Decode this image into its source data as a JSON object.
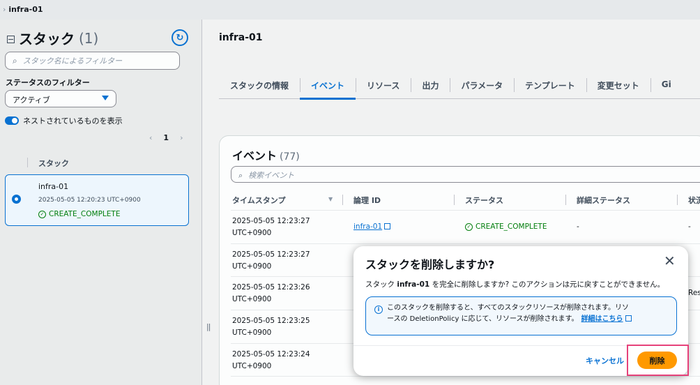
{
  "breadcrumb": {
    "current": "infra-01"
  },
  "left_panel": {
    "title": "スタック",
    "count": "(1)",
    "filter_placeholder": "スタック名によるフィルター",
    "status_filter_label": "ステータスのフィルター",
    "status_selected": "アクティブ",
    "nested_toggle_label": "ネストされているものを表示",
    "page_number": "1",
    "column_header": "スタック",
    "stack": {
      "name": "infra-01",
      "created": "2025-05-05 12:20:23 UTC+0900",
      "status": "CREATE_COMPLETE"
    }
  },
  "main": {
    "title": "infra-01",
    "tabs": [
      {
        "label": "スタックの情報"
      },
      {
        "label": "イベント"
      },
      {
        "label": "リソース"
      },
      {
        "label": "出力"
      },
      {
        "label": "パラメータ"
      },
      {
        "label": "テンプレート"
      },
      {
        "label": "変更セット"
      },
      {
        "label": "Gi"
      }
    ],
    "events": {
      "title": "イベント",
      "count": "(77)",
      "search_placeholder": "検索イベント",
      "headers": [
        "タイムスタンプ",
        "論理 ID",
        "ステータス",
        "詳細ステータス",
        "状況"
      ],
      "rows": [
        {
          "date": "2025-05-05 12:23:27",
          "tz": "UTC+0900",
          "logical_id": "infra-01",
          "status": "CREATE_COMPLETE",
          "detail": "-",
          "reason": "-"
        },
        {
          "date": "2025-05-05 12:23:27",
          "tz": "UTC+0900"
        },
        {
          "date": "2025-05-05 12:23:26",
          "tz": "UTC+0900",
          "reason_partial": "Res"
        },
        {
          "date": "2025-05-05 12:23:25",
          "tz": "UTC+0900"
        },
        {
          "date": "2025-05-05 12:23:24",
          "tz": "UTC+0900"
        }
      ]
    }
  },
  "modal": {
    "title": "スタックを削除しますか?",
    "text_prefix": "スタック ",
    "text_name": "infra-01",
    "text_suffix": " を完全に削除しますか? このアクションは元に戻すことができません。",
    "info_line1": "このスタックを削除すると、すべてのスタックリソースが削除されます。リソ",
    "info_line2": "ースの DeletionPolicy に応じて、リソースが削除されます。",
    "info_link": "詳細はこちら",
    "cancel_label": "キャンセル",
    "delete_label": "削除"
  },
  "colors": {
    "accent": "#0972d3",
    "primary_button": "#ff9900",
    "success": "#037f0c",
    "highlight": "#e6427a"
  }
}
